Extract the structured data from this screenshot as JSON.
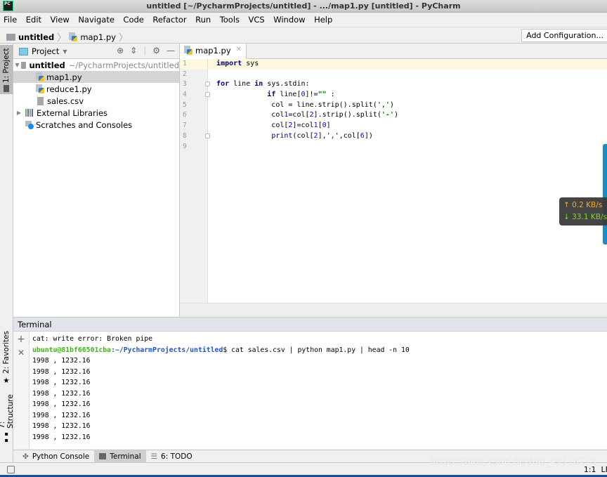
{
  "window": {
    "title": "untitled [~/PycharmProjects/untitled] - .../map1.py [untitled] - PyCharm",
    "app_logo": "PC"
  },
  "menu": [
    "File",
    "Edit",
    "View",
    "Navigate",
    "Code",
    "Refactor",
    "Run",
    "Tools",
    "VCS",
    "Window",
    "Help"
  ],
  "navbar": {
    "breadcrumb": [
      "untitled",
      "map1.py"
    ],
    "add_config_label": "Add Configuration..."
  },
  "left_strip": {
    "project_tab": "1: Project",
    "favorites_tab": "2: Favorites",
    "structure_tab": "7: Structure"
  },
  "project_panel": {
    "view_label": "Project",
    "root": {
      "name": "untitled",
      "path": "~/PycharmProjects/untitled"
    },
    "files": [
      "map1.py",
      "reduce1.py",
      "sales.csv"
    ],
    "external_libraries": "External Libraries",
    "scratches": "Scratches and Consoles"
  },
  "editor": {
    "tab_label": "map1.py",
    "line_numbers": [
      "1",
      "2",
      "3",
      "4",
      "5",
      "6",
      "7",
      "8",
      "9"
    ],
    "code_lines": [
      "import sys",
      "",
      "for line in sys.stdin:",
      "            if line[0]!=\"\" :",
      "             col = line.strip().split(',')",
      "             col1=col[2].strip().split('-')",
      "             col[2]=col1[0]",
      "             print(col[2],',',col[6])",
      ""
    ]
  },
  "network_monitor": {
    "upload": "↑ 0.2 KB/s",
    "download": "↓ 33.1 KB/s"
  },
  "terminal": {
    "title": "Terminal",
    "error_line": "cat: write error: Broken pipe",
    "prompt_user": "ubuntu@81bf66501cba",
    "prompt_path": "~/PycharmProjects/untitled",
    "command": "$ cat sales.csv | python map1.py | head -n 10",
    "output": [
      "1998 , 1232.16",
      "1998 , 1232.16",
      "1998 , 1232.16",
      "1998 , 1232.16",
      "1998 , 1232.16",
      "1998 , 1232.16",
      "1998 , 1232.16",
      "1998 , 1232.16"
    ]
  },
  "bottom_tabs": {
    "python_console": "Python Console",
    "terminal": "Terminal",
    "todo": "6: TODO"
  },
  "status": {
    "position": "1:1",
    "line_sep": "LF"
  },
  "watermark": "https://blog.csdn.net/qq_45578279"
}
